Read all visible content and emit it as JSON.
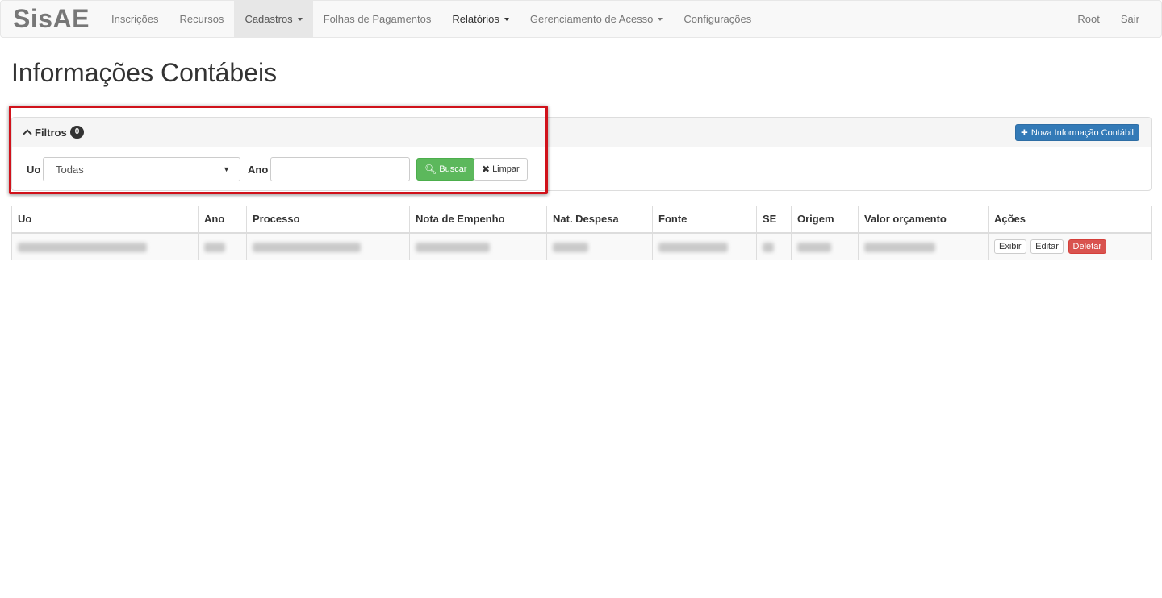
{
  "navbar": {
    "brand": "SisAE",
    "items": [
      {
        "label": "Inscrições"
      },
      {
        "label": "Recursos"
      },
      {
        "label": "Cadastros"
      },
      {
        "label": "Folhas de Pagamentos"
      },
      {
        "label": "Relatórios"
      },
      {
        "label": "Gerenciamento de Acesso"
      },
      {
        "label": "Configurações"
      }
    ],
    "right": [
      {
        "label": "Root"
      },
      {
        "label": "Sair"
      }
    ]
  },
  "page": {
    "title": "Informações Contábeis"
  },
  "filters": {
    "toggle_label": "Filtros",
    "count": "0",
    "new_button_label": "Nova Informação Contábil",
    "uo_label": "Uo",
    "uo_selected": "Todas",
    "ano_label": "Ano",
    "ano_value": "",
    "search_label": "Buscar",
    "clear_label": "Limpar"
  },
  "table": {
    "columns": [
      "Uo",
      "Ano",
      "Processo",
      "Nota de Empenho",
      "Nat. Despesa",
      "Fonte",
      "SE",
      "Origem",
      "Valor orçamento",
      "Ações"
    ],
    "row_actions": {
      "show": "Exibir",
      "edit": "Editar",
      "delete": "Deletar"
    }
  },
  "colors": {
    "primary": "#337ab7",
    "success": "#5cb85c",
    "danger": "#d9534f",
    "highlight": "#d0121b"
  }
}
